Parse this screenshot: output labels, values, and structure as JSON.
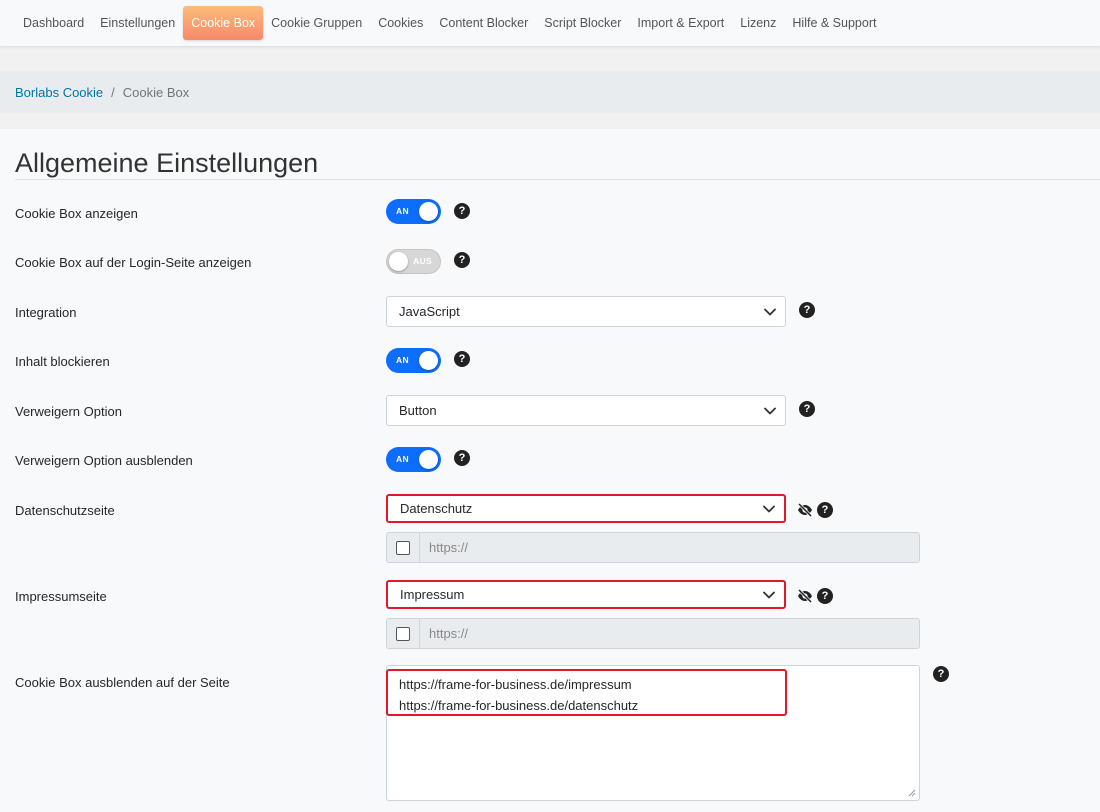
{
  "nav": {
    "items": [
      {
        "label": "Dashboard"
      },
      {
        "label": "Einstellungen"
      },
      {
        "label": "Cookie Box",
        "active": true
      },
      {
        "label": "Cookie Gruppen"
      },
      {
        "label": "Cookies"
      },
      {
        "label": "Content Blocker"
      },
      {
        "label": "Script Blocker"
      },
      {
        "label": "Import & Export"
      },
      {
        "label": "Lizenz"
      },
      {
        "label": "Hilfe & Support"
      }
    ]
  },
  "breadcrumb": {
    "root": "Borlabs Cookie",
    "separator": "/",
    "current": "Cookie Box"
  },
  "section": {
    "title": "Allgemeine Einstellungen"
  },
  "settings": {
    "show_cookie_box": {
      "label": "Cookie Box anzeigen",
      "toggle": "AN"
    },
    "show_on_login": {
      "label": "Cookie Box auf der Login-Seite anzeigen",
      "toggle": "AUS"
    },
    "integration": {
      "label": "Integration",
      "value": "JavaScript"
    },
    "block_content": {
      "label": "Inhalt blockieren",
      "toggle": "AN"
    },
    "refuse_option": {
      "label": "Verweigern Option",
      "value": "Button"
    },
    "hide_refuse_option": {
      "label": "Verweigern Option ausblenden",
      "toggle": "AN"
    },
    "privacy_page": {
      "label": "Datenschutzseite",
      "value": "Datenschutz",
      "url_placeholder": "https://"
    },
    "imprint_page": {
      "label": "Impressumseite",
      "value": "Impressum",
      "url_placeholder": "https://"
    },
    "hide_on_pages": {
      "label": "Cookie Box ausblenden auf der Seite",
      "lines": [
        "https://frame-for-business.de/impressum",
        "https://frame-for-business.de/datenschutz"
      ]
    }
  },
  "help_symbol": "?",
  "colors": {
    "accent": "#0d6efd",
    "active_tab_start": "#fdbb7a",
    "active_tab_end": "#f7896a",
    "highlight": "#e0182c",
    "link": "#0073aa"
  },
  "icons": {
    "help": "question-circle-icon",
    "visibility": "eye-slash-icon",
    "dropdown": "chevron-down-icon",
    "resize": "resize-grip-icon"
  }
}
